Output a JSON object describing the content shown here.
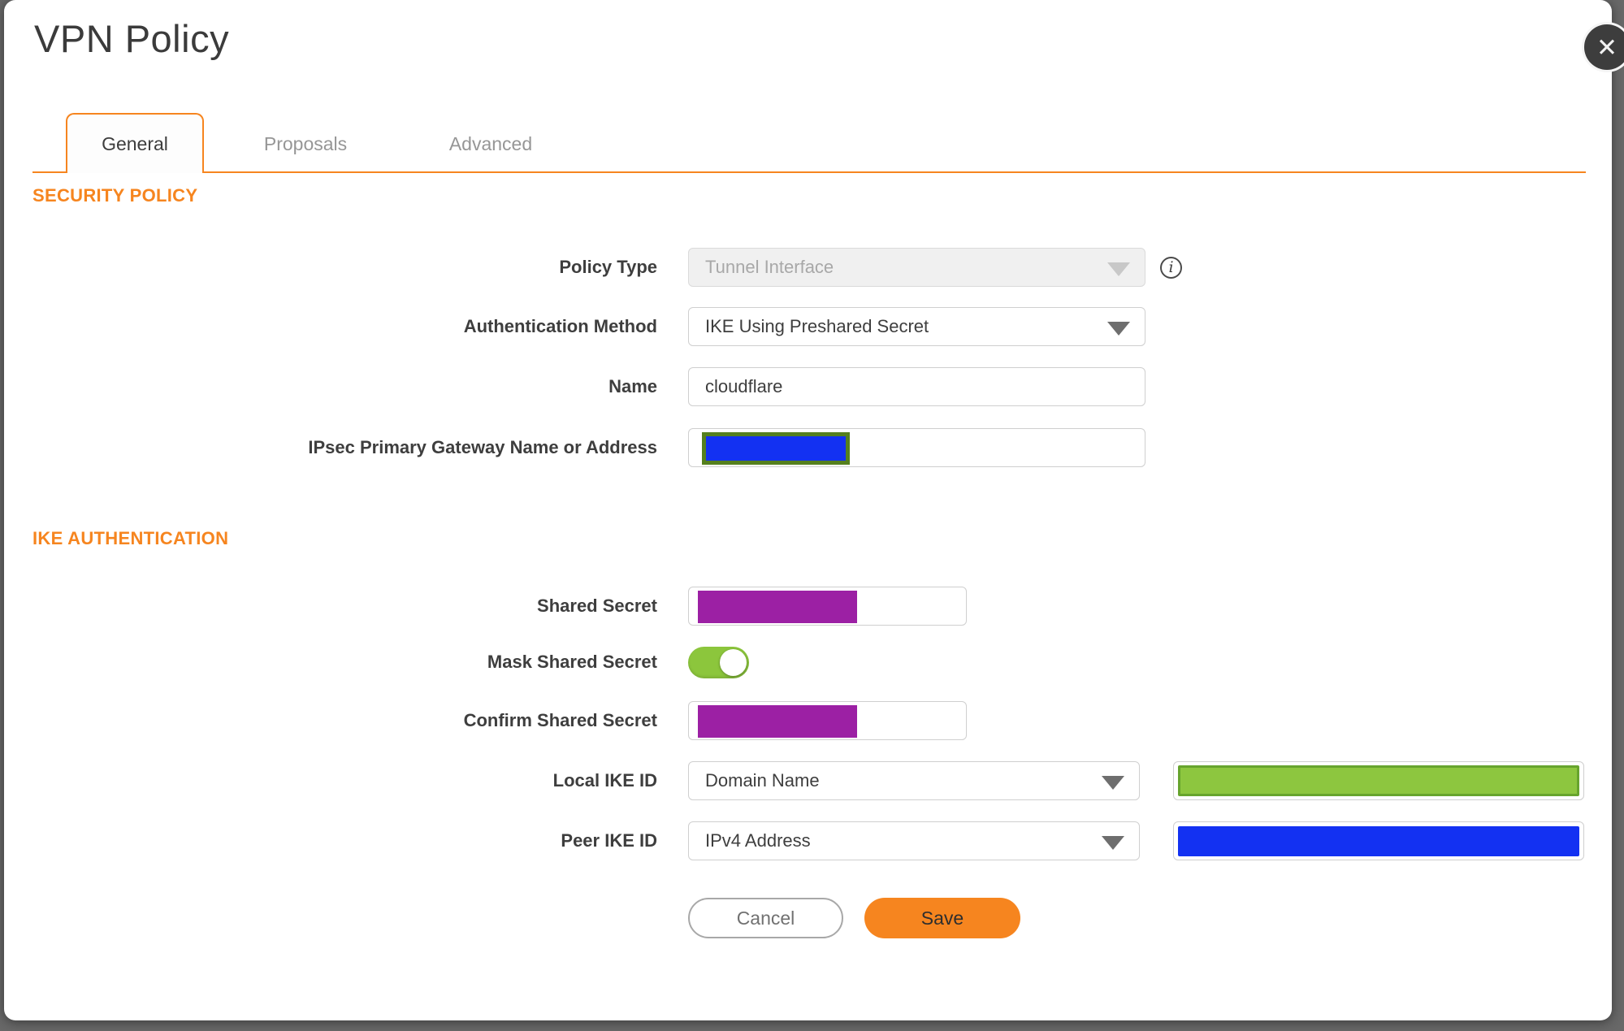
{
  "dialog": {
    "title": "VPN Policy"
  },
  "icons": {
    "close": "✕",
    "info": "i"
  },
  "tabs": [
    {
      "label": "General",
      "active": true
    },
    {
      "label": "Proposals",
      "active": false
    },
    {
      "label": "Advanced",
      "active": false
    }
  ],
  "security_policy": {
    "heading": "SECURITY POLICY",
    "policy_type": {
      "label": "Policy Type",
      "value": "Tunnel Interface",
      "disabled": true
    },
    "auth_method": {
      "label": "Authentication Method",
      "value": "IKE Using Preshared Secret"
    },
    "name": {
      "label": "Name",
      "value": "cloudflare"
    },
    "gateway": {
      "label": "IPsec Primary Gateway Name or Address",
      "value": ""
    }
  },
  "ike_authentication": {
    "heading": "IKE AUTHENTICATION",
    "shared_secret": {
      "label": "Shared Secret",
      "value": ""
    },
    "mask_shared_secret": {
      "label": "Mask Shared Secret",
      "state": "on"
    },
    "confirm_shared_secret": {
      "label": "Confirm Shared Secret",
      "value": ""
    },
    "local_ike_id": {
      "label": "Local IKE ID",
      "value": "Domain Name"
    },
    "peer_ike_id": {
      "label": "Peer IKE ID",
      "value": "IPv4 Address"
    }
  },
  "buttons": {
    "cancel": "Cancel",
    "save": "Save"
  },
  "colors": {
    "accent": "#F6851F",
    "backdrop": "#686868",
    "redaction-blue": "#1331F2",
    "redaction-purple": "#9C20A4",
    "redaction-green": "#8DC63F",
    "green-border": "#67A42D",
    "olive-border": "#55801E",
    "toggle-green": "#8CC63C"
  }
}
